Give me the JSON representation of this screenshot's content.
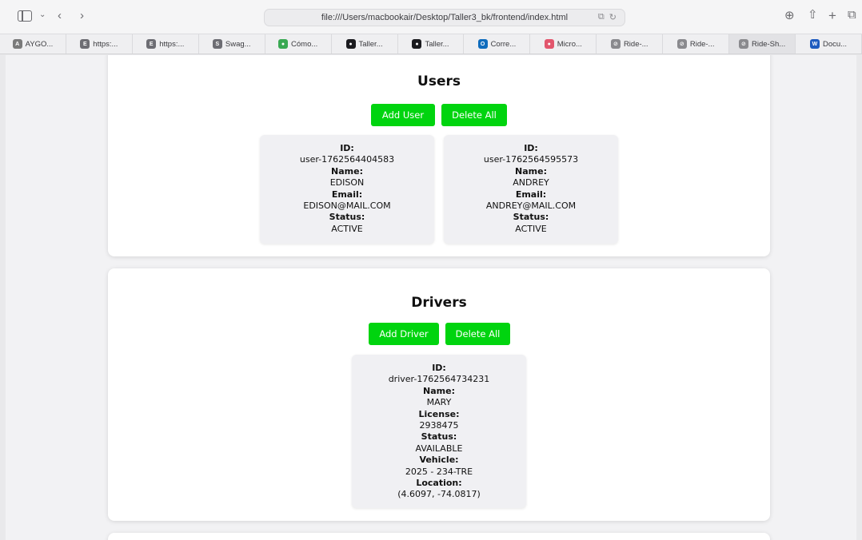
{
  "browser": {
    "url": "file:///Users/macbookair/Desktop/Taller3_bk/frontend/index.html",
    "bookmarks": [
      {
        "label": "AYGO...",
        "color": "#7a7a7a",
        "glyph": "A"
      },
      {
        "label": "https:...",
        "color": "#6d6d73",
        "glyph": "E"
      },
      {
        "label": "https:...",
        "color": "#6d6d73",
        "glyph": "E"
      },
      {
        "label": "Swag...",
        "color": "#6d6d73",
        "glyph": "S"
      },
      {
        "label": "Cómo...",
        "color": "#39a852",
        "glyph": "●"
      },
      {
        "label": "Taller...",
        "color": "#1b1b1f",
        "glyph": "●"
      },
      {
        "label": "Taller...",
        "color": "#1b1b1f",
        "glyph": "●"
      },
      {
        "label": "Corre...",
        "color": "#0f6cbd",
        "glyph": "O"
      },
      {
        "label": "Micro...",
        "color": "#e2566d",
        "glyph": "●"
      },
      {
        "label": "Ride-...",
        "color": "#8a8a8e",
        "glyph": "⊘"
      },
      {
        "label": "Ride-...",
        "color": "#8a8a8e",
        "glyph": "⊘"
      },
      {
        "label": "Ride-Sh...",
        "color": "#8a8a8e",
        "glyph": "⊘"
      },
      {
        "label": "Docu...",
        "color": "#1e5bbf",
        "glyph": "W"
      }
    ]
  },
  "users": {
    "title": "Users",
    "add_label": "Add User",
    "delete_label": "Delete All",
    "labels": {
      "id": "ID:",
      "name": "Name:",
      "email": "Email:",
      "status": "Status:"
    },
    "items": [
      {
        "id": "user-1762564404583",
        "name": "EDISON",
        "email": "EDISON@MAIL.COM",
        "status": "ACTIVE"
      },
      {
        "id": "user-1762564595573",
        "name": "ANDREY",
        "email": "ANDREY@MAIL.COM",
        "status": "ACTIVE"
      }
    ]
  },
  "drivers": {
    "title": "Drivers",
    "add_label": "Add Driver",
    "delete_label": "Delete All",
    "labels": {
      "id": "ID:",
      "name": "Name:",
      "license": "License:",
      "status": "Status:",
      "vehicle": "Vehicle:",
      "location": "Location:"
    },
    "items": [
      {
        "id": "driver-1762564734231",
        "name": "MARY",
        "license": "2938475",
        "status": "AVAILABLE",
        "vehicle": "2025 - 234-TRE",
        "location": "(4.6097, -74.0817)"
      }
    ]
  },
  "accent": "#00d40f"
}
